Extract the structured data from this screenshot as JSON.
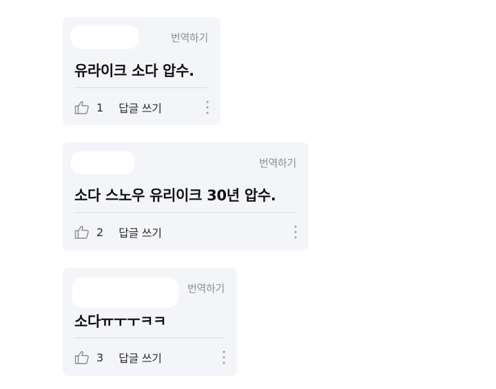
{
  "comments": [
    {
      "translate_label": "번역하기",
      "text": "유라이크 소다 압수.",
      "like_count": "1",
      "reply_label": "답글 쓰기"
    },
    {
      "translate_label": "번역하기",
      "text": "소다 스노우 유리이크 30년 압수.",
      "like_count": "2",
      "reply_label": "답글 쓰기"
    },
    {
      "translate_label": "번역하기",
      "text": "소다ㅠㅜㅜㅋㅋ",
      "like_count": "3",
      "reply_label": "답글 쓰기"
    }
  ]
}
